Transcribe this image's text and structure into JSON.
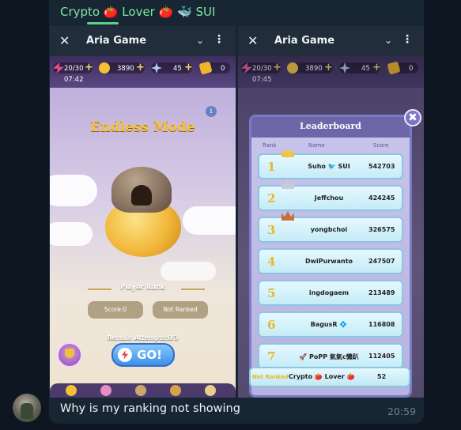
{
  "chat": {
    "sender_name": "Crypto 🍅 Lover 🍅 🐳 SUI",
    "message_text": "Why is my ranking not showing",
    "message_time": "20:59"
  },
  "screens": {
    "left": {
      "appbar": {
        "close_icon": "✕",
        "title": "Aria Game",
        "chevron_icon": "⌄",
        "menu_icon": "⋮"
      },
      "hud": {
        "energy": "20/30",
        "energy_timer": "07:42",
        "coins": "3890",
        "stars": "45",
        "tickets": "0"
      },
      "mode_title": "Endless Mode",
      "info_icon": "i",
      "player_rank_label": "Player Rank",
      "score_label": "Score:0",
      "rank_status": "Not Ranked",
      "remain_attempts": "Remain Attempts:0/3",
      "go_label": "GO!"
    },
    "right": {
      "appbar": {
        "close_icon": "✕",
        "title": "Aria Game",
        "chevron_icon": "⌄",
        "menu_icon": "⋮"
      },
      "hud": {
        "energy": "20/30",
        "energy_timer": "07:45",
        "coins": "3890",
        "stars": "45",
        "tickets": "0"
      },
      "leaderboard": {
        "title": "Leaderboard",
        "close_icon": "✖",
        "headers": {
          "rank": "Rank",
          "name": "Name",
          "score": "Score"
        },
        "rows": [
          {
            "rank": "1",
            "name": "Suho 🐦 SUI",
            "score": "542703",
            "crown": "#f3c53a"
          },
          {
            "rank": "2",
            "name": "Jeffchou",
            "score": "424245",
            "crown": "#c9ccd8"
          },
          {
            "rank": "3",
            "name": "yongbchoi",
            "score": "326575",
            "crown": "#c6703b"
          },
          {
            "rank": "4",
            "name": "DwiPurwanto",
            "score": "247507"
          },
          {
            "rank": "5",
            "name": "ingdogaem",
            "score": "213489"
          },
          {
            "rank": "6",
            "name": "BagusR 💠",
            "score": "116808"
          },
          {
            "rank": "7",
            "name": "🚀 PoPP 氣氣c懶趴",
            "score": "112405"
          }
        ],
        "self_row": {
          "rank": "Not Ranked",
          "name": "Crypto 🍅 Lover 🍅",
          "score": "52"
        }
      }
    }
  }
}
